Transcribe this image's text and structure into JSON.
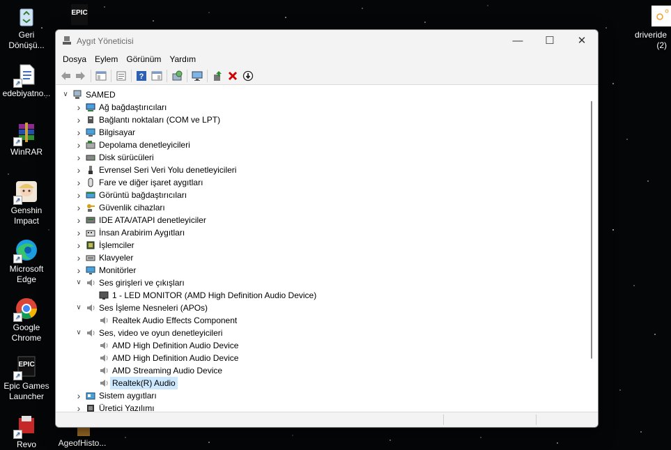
{
  "desktop": {
    "icons_left": [
      {
        "label": "Geri\nDönüşü...",
        "icon": "recycle-bin-icon"
      },
      {
        "label": "edebiyatno...",
        "icon": "document-icon"
      },
      {
        "label": "WinRAR",
        "icon": "winrar-icon"
      },
      {
        "label": "Genshin\nImpact",
        "icon": "genshin-icon"
      },
      {
        "label": "Microsoft\nEdge",
        "icon": "edge-icon"
      },
      {
        "label": "Google\nChrome",
        "icon": "chrome-icon"
      },
      {
        "label": "Epic Games\nLauncher",
        "icon": "epic-games-icon"
      },
      {
        "label": "Revo",
        "icon": "revo-icon"
      }
    ],
    "top_epic_label": "EPIC",
    "bottom_age": "AgeofHisto...",
    "driver_label": "driveride\n(2)"
  },
  "window": {
    "title": "Aygıt Yöneticisi",
    "caption": {
      "minimize": "—",
      "maximize": "☐",
      "close": "✕"
    },
    "menu": [
      "Dosya",
      "Eylem",
      "Görünüm",
      "Yardım"
    ]
  },
  "tree": {
    "root": "SAMED",
    "items": [
      {
        "label": "Ağ bağdaştırıcıları",
        "icon": "network-adapter-icon",
        "expanded": false,
        "level": 1
      },
      {
        "label": "Bağlantı noktaları (COM ve LPT)",
        "icon": "port-icon",
        "expanded": false,
        "level": 1
      },
      {
        "label": "Bilgisayar",
        "icon": "computer-icon",
        "expanded": false,
        "level": 1
      },
      {
        "label": "Depolama denetleyicileri",
        "icon": "storage-controller-icon",
        "expanded": false,
        "level": 1
      },
      {
        "label": "Disk sürücüleri",
        "icon": "disk-drive-icon",
        "expanded": false,
        "level": 1
      },
      {
        "label": "Evrensel Seri Veri Yolu denetleyicileri",
        "icon": "usb-icon",
        "expanded": false,
        "level": 1
      },
      {
        "label": "Fare ve diğer işaret aygıtları",
        "icon": "mouse-icon",
        "expanded": false,
        "level": 1
      },
      {
        "label": "Görüntü bağdaştırıcıları",
        "icon": "display-adapter-icon",
        "expanded": false,
        "level": 1
      },
      {
        "label": "Güvenlik cihazları",
        "icon": "security-device-icon",
        "expanded": false,
        "level": 1
      },
      {
        "label": "IDE ATA/ATAPI denetleyiciler",
        "icon": "ide-controller-icon",
        "expanded": false,
        "level": 1
      },
      {
        "label": "İnsan Arabirim Aygıtları",
        "icon": "hid-icon",
        "expanded": false,
        "level": 1
      },
      {
        "label": "İşlemciler",
        "icon": "processor-icon",
        "expanded": false,
        "level": 1
      },
      {
        "label": "Klavyeler",
        "icon": "keyboard-icon",
        "expanded": false,
        "level": 1
      },
      {
        "label": "Monitörler",
        "icon": "monitor-icon",
        "expanded": false,
        "level": 1
      },
      {
        "label": "Ses girişleri ve çıkışları",
        "icon": "speaker-icon",
        "expanded": true,
        "level": 1
      },
      {
        "label": "1 - LED MONITOR (AMD High Definition Audio Device)",
        "icon": "monitor-audio-icon",
        "level": 2
      },
      {
        "label": "Ses İşleme Nesneleri (APOs)",
        "icon": "speaker-icon",
        "expanded": true,
        "level": 1
      },
      {
        "label": "Realtek Audio Effects Component",
        "icon": "speaker-icon",
        "level": 2
      },
      {
        "label": "Ses, video ve oyun denetleyicileri",
        "icon": "speaker-icon",
        "expanded": true,
        "level": 1
      },
      {
        "label": "AMD High Definition Audio Device",
        "icon": "speaker-icon",
        "level": 2
      },
      {
        "label": "AMD High Definition Audio Device",
        "icon": "speaker-icon",
        "level": 2
      },
      {
        "label": "AMD Streaming Audio Device",
        "icon": "speaker-icon",
        "level": 2
      },
      {
        "label": "Realtek(R) Audio",
        "icon": "speaker-icon",
        "level": 2,
        "selected": true
      },
      {
        "label": "Sistem aygıtları",
        "icon": "system-device-icon",
        "expanded": false,
        "level": 1
      },
      {
        "label": "Üretici Yazılımı",
        "icon": "firmware-icon",
        "expanded": false,
        "level": 1
      }
    ]
  },
  "colors": {
    "selection": "#cce8ff",
    "titlebar": "#f3f3f3",
    "remove_red": "#d00000",
    "update_green": "#2c8a2c"
  }
}
